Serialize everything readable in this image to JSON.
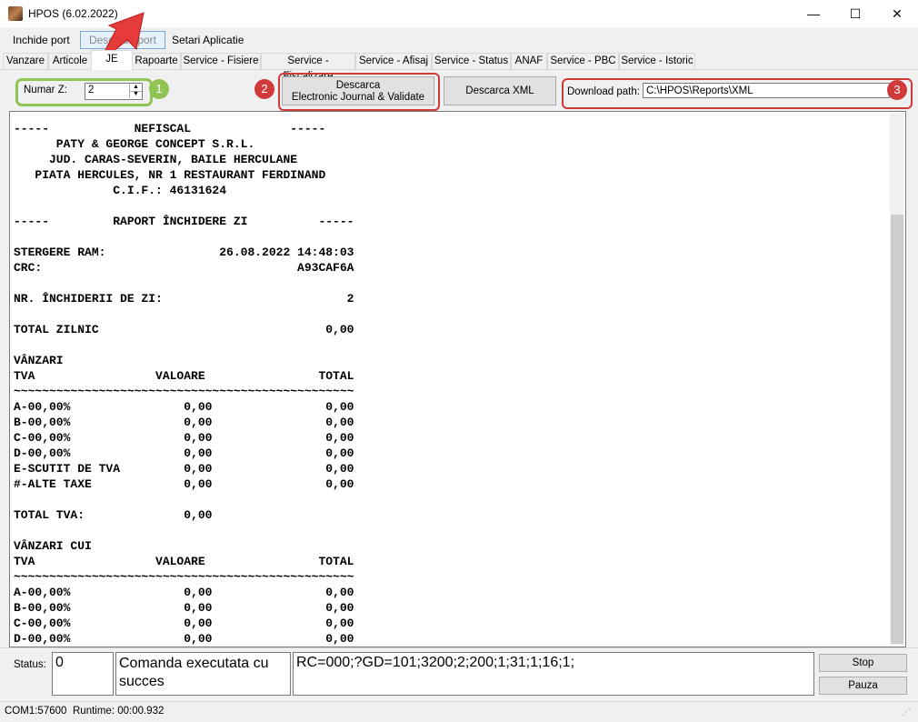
{
  "window": {
    "title": "HPOS (6.02.2022)",
    "minimize_glyph": "—",
    "maximize_glyph": "☐",
    "close_glyph": "✕"
  },
  "menu": {
    "items": [
      "Inchide port",
      "Deschide port",
      "Setari Aplicatie"
    ]
  },
  "tabs": [
    "Vanzare",
    "Articole",
    "JE",
    "Rapoarte",
    "Service - Fisiere",
    "Service - Fiscalizare",
    "Service - Afisaj",
    "Service - Status",
    "ANAF",
    "Service - PBC",
    "Service - Istoric"
  ],
  "je": {
    "numar_z_label": "Numar Z:",
    "numar_z_value": "2",
    "descarca_line1": "Descarca",
    "descarca_line2": "Electronic Journal & Validate",
    "descarca_xml": "Descarca XML",
    "download_path_label": "Download path:",
    "download_path_value": "C:\\HPOS\\Reports\\XML"
  },
  "annotations": {
    "badge1": "1",
    "badge2": "2",
    "badge3": "3",
    "green": "#8fc454",
    "red": "#d13a3a"
  },
  "report": {
    "lines": [
      "-----            NEFISCAL              -----",
      "      PATY & GEORGE CONCEPT S.R.L.",
      "     JUD. CARAS-SEVERIN, BAILE HERCULANE",
      "   PIATA HERCULES, NR 1 RESTAURANT FERDINAND",
      "              C.I.F.: 46131624",
      "",
      "-----         RAPORT ÎNCHIDERE ZI          -----",
      "",
      "STERGERE RAM:                26.08.2022 14:48:03",
      "CRC:                                    A93CAF6A",
      "",
      "NR. ÎNCHIDERII DE ZI:                          2",
      "",
      "TOTAL ZILNIC                                0,00",
      "",
      "VÂNZARI",
      "TVA                 VALOARE                TOTAL",
      "~~~~~~~~~~~~~~~~~~~~~~~~~~~~~~~~~~~~~~~~~~~~~~~~",
      "A-00,00%                0,00                0,00",
      "B-00,00%                0,00                0,00",
      "C-00,00%                0,00                0,00",
      "D-00,00%                0,00                0,00",
      "E-SCUTIT DE TVA         0,00                0,00",
      "#-ALTE TAXE             0,00                0,00",
      "",
      "TOTAL TVA:              0,00",
      "",
      "VÂNZARI CUI",
      "TVA                 VALOARE                TOTAL",
      "~~~~~~~~~~~~~~~~~~~~~~~~~~~~~~~~~~~~~~~~~~~~~~~~",
      "A-00,00%                0,00                0,00",
      "B-00,00%                0,00                0,00",
      "C-00,00%                0,00                0,00",
      "D-00,00%                0,00                0,00"
    ]
  },
  "status": {
    "label": "Status:",
    "code": "0",
    "message": "Comanda executata cu succes",
    "response": "RC=000;?GD=101;3200;2;200;1;31;1;16;1;",
    "stop_button": "Stop",
    "pause_button": "Pauza"
  },
  "statusbar": {
    "port_info": "COM1:57600",
    "runtime": "Runtime: 00:00.932"
  }
}
